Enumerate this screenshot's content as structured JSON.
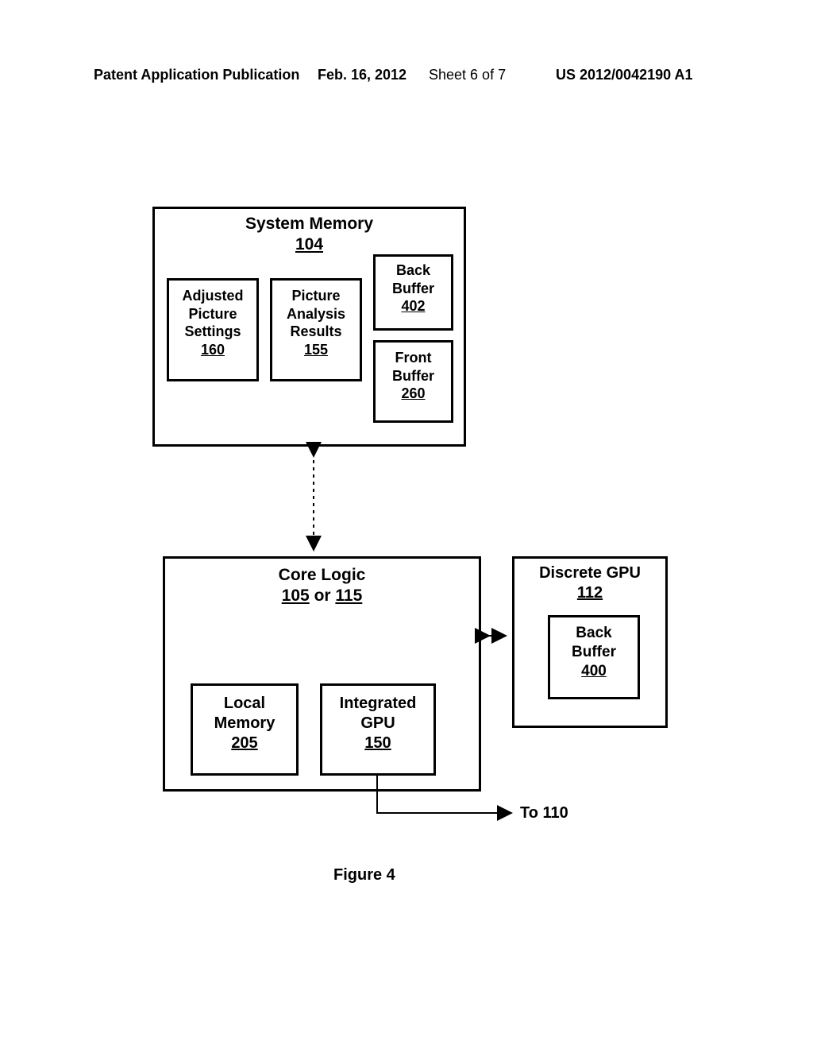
{
  "header": {
    "publication": "Patent Application Publication",
    "date": "Feb. 16, 2012",
    "sheet": "Sheet 6 of 7",
    "number": "US 2012/0042190 A1"
  },
  "sysmem": {
    "title": "System Memory",
    "ref": "104",
    "adjusted": {
      "l1": "Adjusted",
      "l2": "Picture",
      "l3": "Settings",
      "ref": "160"
    },
    "analysis": {
      "l1": "Picture",
      "l2": "Analysis",
      "l3": "Results",
      "ref": "155"
    },
    "back": {
      "l1": "Back",
      "l2": "Buffer",
      "ref": "402"
    },
    "front": {
      "l1": "Front",
      "l2": "Buffer",
      "ref": "260"
    }
  },
  "core": {
    "title": "Core Logic",
    "ref1": "105",
    "or": " or ",
    "ref2": "115",
    "local": {
      "l1": "Local",
      "l2": "Memory",
      "ref": "205"
    },
    "igpu": {
      "l1": "Integrated",
      "l2": "GPU",
      "ref": "150"
    }
  },
  "dgpu": {
    "title": "Discrete GPU",
    "ref": "112",
    "back": {
      "l1": "Back",
      "l2": "Buffer",
      "ref": "400"
    }
  },
  "to110": "To 110",
  "caption": "Figure 4"
}
